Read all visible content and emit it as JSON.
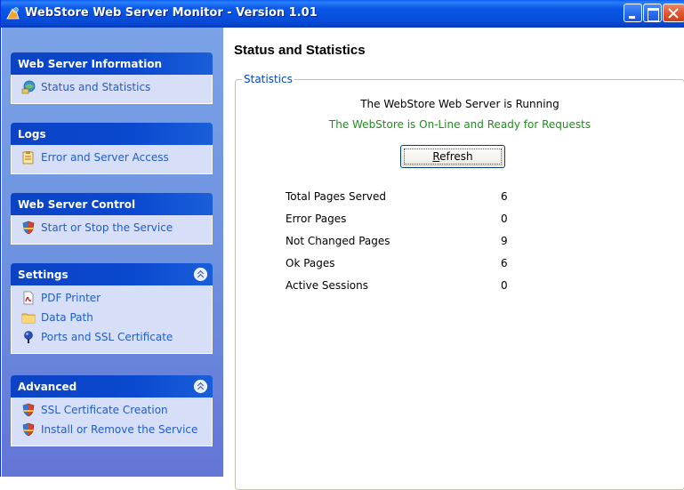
{
  "window": {
    "title": "WebStore Web Server Monitor - Version 1.01"
  },
  "sidebar": {
    "groups": [
      {
        "header": "Web Server Information",
        "items": [
          {
            "label": "Status and Statistics",
            "icon": "globe-network-icon"
          }
        ]
      },
      {
        "header": "Logs",
        "items": [
          {
            "label": "Error and Server Access",
            "icon": "clipboard-log-icon"
          }
        ]
      },
      {
        "header": "Web Server Control",
        "items": [
          {
            "label": "Start or Stop the Service",
            "icon": "shield-icon"
          }
        ]
      },
      {
        "header": "Settings",
        "collapsible": true,
        "items": [
          {
            "label": "PDF Printer",
            "icon": "pdf-icon"
          },
          {
            "label": "Data Path",
            "icon": "folder-icon"
          },
          {
            "label": "Ports and SSL Certificate",
            "icon": "network-pin-icon"
          }
        ]
      },
      {
        "header": "Advanced",
        "collapsible": true,
        "items": [
          {
            "label": "SSL Certificate Creation",
            "icon": "shield-icon"
          },
          {
            "label": "Install or Remove the Service",
            "icon": "shield-icon"
          }
        ]
      }
    ]
  },
  "main": {
    "title": "Status and Statistics",
    "statistics_legend": "Statistics",
    "status_text": "The WebStore Web Server is Running",
    "online_text": "The WebStore is On-Line and Ready for Requests",
    "refresh_label_mnemonic": "R",
    "refresh_label_rest": "efresh",
    "stats": [
      {
        "label": "Total Pages Served",
        "value": "6"
      },
      {
        "label": "Error Pages",
        "value": "0"
      },
      {
        "label": "Not Changed Pages",
        "value": "9"
      },
      {
        "label": "Ok Pages",
        "value": "6"
      },
      {
        "label": "Active Sessions",
        "value": "0"
      }
    ]
  },
  "colors": {
    "titlebar": "#0a58e8",
    "sidebar_background": "#7ba2e7",
    "group_header": "#0c43c4",
    "group_body": "#d6dff7",
    "link_text": "#215dc6",
    "online_text": "#1e8f1e",
    "legend_text": "#0046d5"
  }
}
